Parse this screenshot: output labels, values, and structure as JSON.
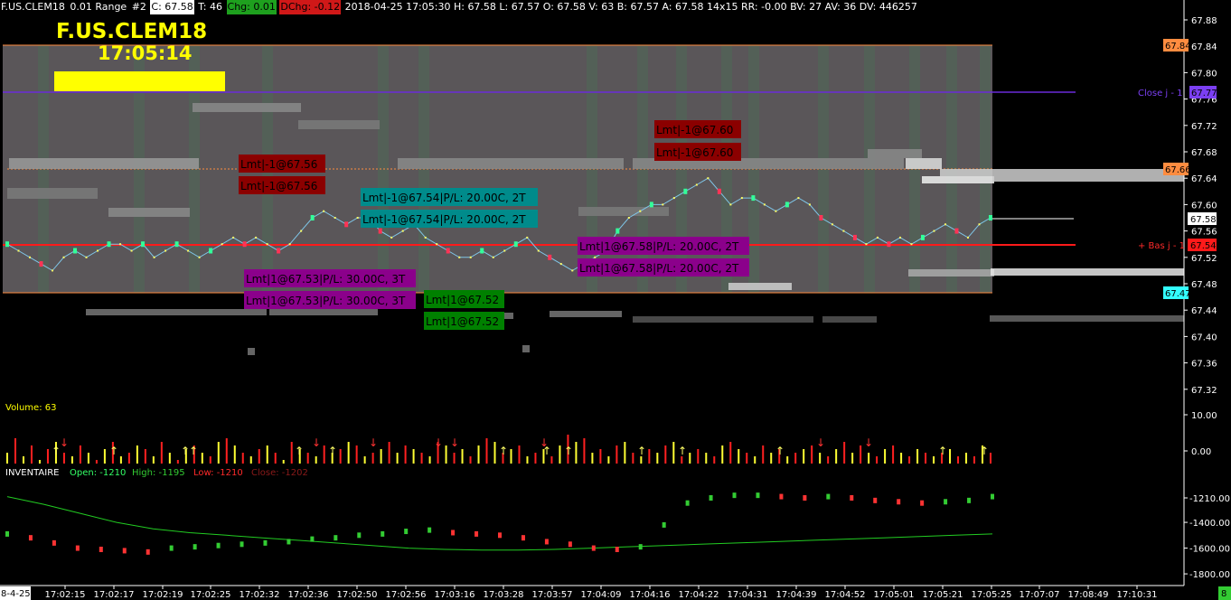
{
  "header": {
    "symbol": "F.US.CLEM18",
    "tick": "0.01 Range",
    "chart_no": "#2",
    "close": "C: 67.58",
    "ticks": "T: 46",
    "chg": "Chg: 0.01",
    "dchg": "DChg: -0.12",
    "details": "2018-04-25 17:05:30 H: 67.58 L: 67.57 O: 67.58 V: 63 B: 67.57 A: 67.58 14x15 RR: -0.00 BV: 27 AV: 36 DV: 446257"
  },
  "overlay": {
    "symbol": "F.US.CLEM18",
    "clock": "17:05:14"
  },
  "levels": {
    "close_label": "Close j - 1",
    "close_value": "67.77",
    "bas_label": "+ Bas j - 1",
    "bas_value": "67.54",
    "high_value": "67.84",
    "mid_value": "67.66",
    "last_value": "67.58",
    "low_value": "67.47"
  },
  "orders": {
    "sell1": "Lmt|-1@67.56",
    "sell2": "Lmt|-1@67.60",
    "exit1": "Lmt|-1@67.54|P/L: 20.00C, 2T",
    "exit2": "Lmt|1@67.58|P/L: 20.00C, 2T",
    "exit3": "Lmt|1@67.53|P/L: 30.00C, 3T",
    "buy1": "Lmt|1@67.52"
  },
  "volume_pane": {
    "label": "Volume: 63"
  },
  "inventaire": {
    "title": "INVENTAIRE",
    "open": "Open: -1210",
    "high": "High: -1195",
    "low": "Low: -1210",
    "close": "Close: -1202"
  },
  "xaxis": {
    "first": "8-4-25",
    "last_box": "8",
    "ticks": [
      "17:02:15",
      "17:02:17",
      "17:02:19",
      "17:02:25",
      "17:02:32",
      "17:02:36",
      "17:02:50",
      "17:02:56",
      "17:03:16",
      "17:03:28",
      "17:03:57",
      "17:04:09",
      "17:04:16",
      "17:04:22",
      "17:04:31",
      "17:04:39",
      "17:04:52",
      "17:05:01",
      "17:05:21",
      "17:05:25",
      "17:07:07",
      "17:08:49",
      "17:10:31"
    ]
  },
  "colors": {
    "up": "#33ff99",
    "down": "#ff3355",
    "volume_up": "#ffff33",
    "volume_down": "#ff2020",
    "support": "#ff1a1a",
    "resistance": "#6a2bd9"
  },
  "chart_data": [
    {
      "type": "line",
      "title": "F.US.CLEM18",
      "ylabel": "",
      "ylim": [
        67.3,
        67.88
      ],
      "y_ticks": [
        "67.88",
        "67.84",
        "67.80",
        "67.76",
        "67.72",
        "67.68",
        "67.64",
        "67.60",
        "67.56",
        "67.52",
        "67.48",
        "67.44",
        "67.40",
        "67.36",
        "67.32"
      ],
      "series": [
        {
          "values": [
            67.54,
            67.53,
            67.52,
            67.51,
            67.5,
            67.52,
            67.53,
            67.52,
            67.53,
            67.54,
            67.54,
            67.53,
            67.54,
            67.52,
            67.53,
            67.54,
            67.53,
            67.52,
            67.53,
            67.54,
            67.55,
            67.54,
            67.55,
            67.54,
            67.53,
            67.54,
            67.56,
            67.58,
            67.59,
            67.58,
            67.57,
            67.58,
            67.58,
            67.56,
            67.55,
            67.56,
            67.57,
            67.55,
            67.54,
            67.53,
            67.52,
            67.52,
            67.53,
            67.52,
            67.53,
            67.54,
            67.55,
            67.53,
            67.52,
            67.51,
            67.5,
            67.51,
            67.52,
            67.53,
            67.56,
            67.58,
            67.59,
            67.6,
            67.6,
            67.61,
            67.62,
            67.63,
            67.64,
            67.62,
            67.6,
            67.61,
            67.61,
            67.6,
            67.59,
            67.6,
            67.61,
            67.6,
            67.58,
            67.57,
            67.56,
            67.55,
            67.54,
            67.55,
            67.54,
            67.55,
            67.54,
            67.55,
            67.56,
            67.57,
            67.56,
            67.55,
            67.57,
            67.58
          ]
        }
      ]
    },
    {
      "type": "bar",
      "title": "Volume: 63",
      "ylim": [
        -5,
        12
      ],
      "y_ticks": [
        "10.00",
        "0.00"
      ],
      "values": [
        3,
        7,
        2,
        5,
        1,
        4,
        6,
        3,
        2,
        5,
        3,
        1,
        4,
        6,
        2,
        3,
        5,
        4,
        2,
        6,
        3,
        1,
        4,
        5,
        3,
        2,
        6,
        7,
        5,
        3,
        2,
        4,
        5,
        3,
        1,
        6,
        4,
        3,
        2,
        5,
        3,
        4,
        6,
        5,
        2,
        3,
        4,
        6,
        3,
        5,
        4,
        3,
        2,
        6,
        5,
        3,
        4,
        2,
        5,
        7,
        6,
        3,
        4,
        5,
        2,
        3,
        4,
        2,
        5,
        8,
        6,
        7,
        3,
        4,
        2,
        5,
        6,
        3,
        2,
        4,
        3,
        5,
        6,
        2,
        3,
        4,
        3,
        2,
        5,
        6,
        4,
        3,
        2,
        5,
        3,
        4,
        2,
        3,
        4,
        5,
        3,
        2,
        4,
        6,
        3,
        5,
        3,
        2,
        4,
        5,
        3,
        2,
        4,
        3,
        2,
        3,
        4,
        2,
        3,
        2,
        5,
        3
      ],
      "marker_up": "↑",
      "marker_down": "↓"
    },
    {
      "type": "line",
      "title": "INVENTAIRE",
      "ylim": [
        -1820,
        -1150
      ],
      "y_ticks": [
        "-1210.00",
        "-1400.00",
        "-1600.00",
        "-1800.00"
      ],
      "series": [
        {
          "values": [
            -1490,
            -1520,
            -1560,
            -1600,
            -1610,
            -1620,
            -1630,
            -1600,
            -1590,
            -1580,
            -1570,
            -1560,
            -1550,
            -1530,
            -1520,
            -1500,
            -1490,
            -1470,
            -1460,
            -1480,
            -1490,
            -1500,
            -1520,
            -1550,
            -1570,
            -1600,
            -1610,
            -1590,
            -1420,
            -1250,
            -1210,
            -1190,
            -1190,
            -1200,
            -1210,
            -1200,
            -1210,
            -1230,
            -1240,
            -1250,
            -1240,
            -1230,
            -1200
          ]
        },
        {
          "values": [
            -1200,
            -1260,
            -1330,
            -1400,
            -1450,
            -1480,
            -1500,
            -1520,
            -1540,
            -1560,
            -1580,
            -1600,
            -1610,
            -1615,
            -1615,
            -1610,
            -1600,
            -1590,
            -1580,
            -1570,
            -1560,
            -1550,
            -1540,
            -1530,
            -1520,
            -1510,
            -1500,
            -1490
          ]
        }
      ]
    }
  ]
}
